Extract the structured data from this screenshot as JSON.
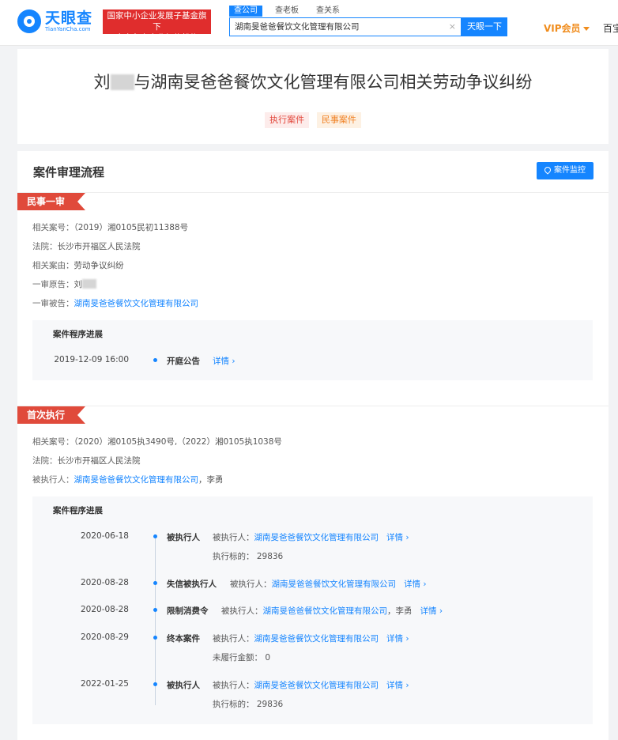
{
  "header": {
    "logo_cn": "天眼查",
    "logo_en": "TianYanCha.com",
    "badge_line1": "国家中小企业发展子基金旗下",
    "badge_line2": "官方备案企业征信机构",
    "tabs": [
      "查公司",
      "查老板",
      "查关系"
    ],
    "search_value": "湖南旻爸爸餐饮文化管理有限公司",
    "search_clear": "×",
    "search_button": "天眼一下",
    "vip_label": "VIP会员",
    "nav_cut": "百宝"
  },
  "case": {
    "title_prefix": "刘",
    "title_suffix": "与湖南旻爸爸餐饮文化管理有限公司相关劳动争议纠纷",
    "tags": [
      "执行案件",
      "民事案件"
    ]
  },
  "process": {
    "heading": "案件审理流程",
    "monitor_button": "案件监控",
    "first_trial": {
      "ribbon": "民事一审",
      "rows": [
        {
          "label": "相关案号：",
          "value": "（2019）湘0105民初11388号"
        },
        {
          "label": "法院：",
          "value": "长沙市开福区人民法院"
        },
        {
          "label": "相关案由：",
          "value": "劳动争议纠纷"
        },
        {
          "label": "一审原告：",
          "value": "刘"
        },
        {
          "label": "一审被告：",
          "value": "湖南旻爸爸餐饮文化管理有限公司"
        }
      ],
      "progress_title": "案件程序进展",
      "timeline": [
        {
          "date": "2019-12-09 16:00",
          "type": "开庭公告",
          "detail": "详情"
        }
      ]
    },
    "first_execution": {
      "ribbon": "首次执行",
      "rows": [
        {
          "label": "相关案号：",
          "value": "（2020）湘0105执3490号,（2022）湘0105执1038号"
        },
        {
          "label": "法院：",
          "value": "长沙市开福区人民法院"
        },
        {
          "label": "被执行人：",
          "value": "湖南旻爸爸餐饮文化管理有限公司",
          "extra": "，李勇"
        }
      ],
      "progress_title": "案件程序进展",
      "timeline": [
        {
          "date": "2020-06-18",
          "type": "被执行人",
          "desc_label": "被执行人：",
          "desc_link": "湖南旻爸爸餐饮文化管理有限公司",
          "desc_extra": "",
          "detail": "详情",
          "sub": "执行标的：  29836"
        },
        {
          "date": "2020-08-28",
          "type": "失信被执行人",
          "desc_label": "被执行人：",
          "desc_link": "湖南旻爸爸餐饮文化管理有限公司",
          "desc_extra": "",
          "detail": "详情",
          "sub": ""
        },
        {
          "date": "2020-08-28",
          "type": "限制消费令",
          "desc_label": "被执行人：",
          "desc_link": "湖南旻爸爸餐饮文化管理有限公司",
          "desc_extra": "，李勇",
          "detail": "详情",
          "sub": ""
        },
        {
          "date": "2020-08-29",
          "type": "终本案件",
          "desc_label": "被执行人：",
          "desc_link": "湖南旻爸爸餐饮文化管理有限公司",
          "desc_extra": "",
          "detail": "详情",
          "sub": "未履行金额：  0"
        },
        {
          "date": "2022-01-25",
          "type": "被执行人",
          "desc_label": "被执行人：",
          "desc_link": "湖南旻爸爸餐饮文化管理有限公司",
          "desc_extra": "",
          "detail": "详情",
          "sub": "执行标的：  29836"
        }
      ]
    }
  }
}
